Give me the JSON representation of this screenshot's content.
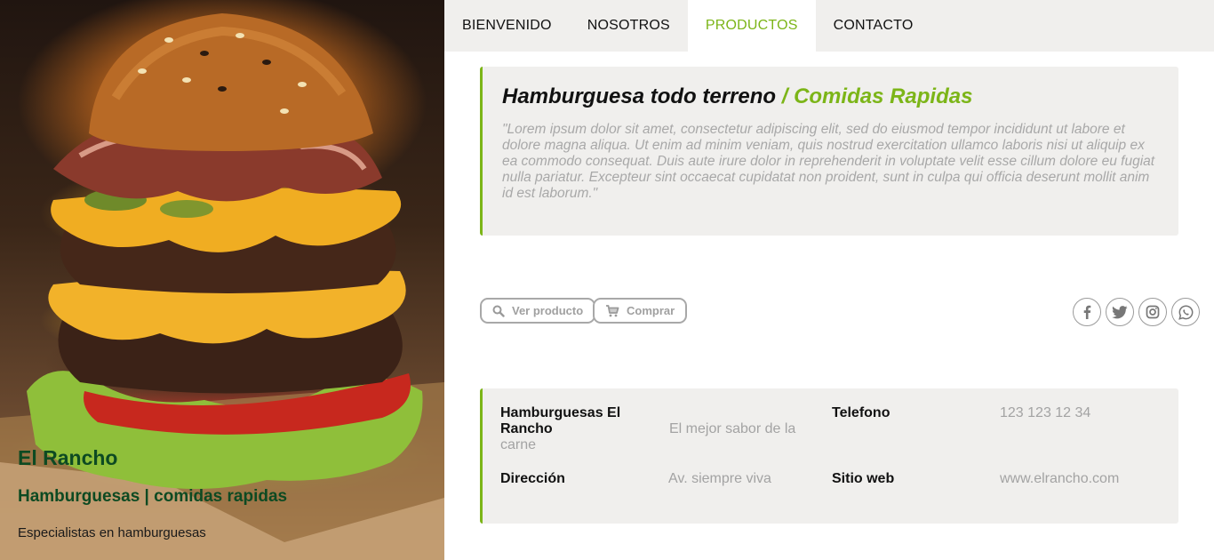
{
  "hero": {
    "title": "El Rancho",
    "subtitle": "Hamburguesas | comidas rapidas",
    "tagline": "Especialistas en hamburguesas"
  },
  "nav": {
    "items": [
      {
        "label": "BIENVENIDO",
        "active": false
      },
      {
        "label": "NOSOTROS",
        "active": false
      },
      {
        "label": "PRODUCTOS",
        "active": true
      },
      {
        "label": "CONTACTO",
        "active": false
      }
    ]
  },
  "product": {
    "name": "Hamburguesa todo terreno",
    "separator": "/",
    "category": "Comidas Rapidas",
    "description": "\"Lorem ipsum dolor sit amet, consectetur adipiscing elit, sed do eiusmod tempor incididunt ut labore et dolore magna aliqua. Ut enim ad minim veniam, quis nostrud exercitation ullamco laboris nisi ut aliquip ex ea commodo consequat. Duis aute irure dolor in reprehenderit in voluptate velit esse cillum dolore eu fugiat nulla pariatur. Excepteur sint occaecat cupidatat non proident, sunt in culpa qui officia deserunt mollit anim id est laborum.\""
  },
  "actions": {
    "view_label": "Ver producto",
    "view_icon": "search-icon",
    "buy_label": "Comprar",
    "buy_icon": "cart-icon"
  },
  "social": [
    "facebook-icon",
    "twitter-icon",
    "instagram-icon",
    "whatsapp-icon"
  ],
  "info": {
    "business_name": "Hamburguesas El Rancho",
    "business_slogan": "El mejor sabor de la carne",
    "phone_label": "Telefono",
    "phone_value": "123 123 12 34",
    "address_label": "Dirección",
    "address_value": "Av. siempre viva",
    "website_label": "Sitio web",
    "website_value": "www.elrancho.com"
  },
  "colors": {
    "accent": "#7cb518",
    "hero_text": "#0d4a22",
    "panel_bg": "#f0efed",
    "muted_text": "#a8a8a8"
  }
}
